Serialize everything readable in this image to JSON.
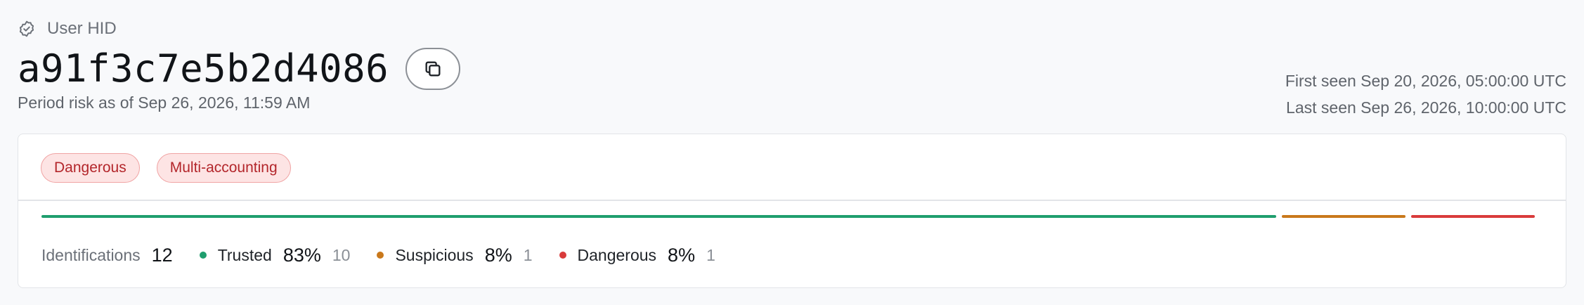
{
  "header": {
    "label": "User HID",
    "hid": "a91f3c7e5b2d4086",
    "period": "Period risk as of Sep 26, 2026, 11:59 AM",
    "first_seen": "First seen Sep 20, 2026, 05:00:00 UTC",
    "last_seen": "Last seen Sep 26, 2026, 10:00:00 UTC"
  },
  "tags": [
    "Dangerous",
    "Multi-accounting"
  ],
  "identifications": {
    "label": "Identifications",
    "total": "12",
    "groups": [
      {
        "label": "Trusted",
        "percent": "83%",
        "count": "10",
        "color": "#1f9e6e",
        "share": 0.83
      },
      {
        "label": "Suspicious",
        "percent": "8%",
        "count": "1",
        "color": "#c9781b",
        "share": 0.083
      },
      {
        "label": "Dangerous",
        "percent": "8%",
        "count": "1",
        "color": "#d93b3b",
        "share": 0.083
      }
    ]
  },
  "icons": {
    "check": "check-circle-icon",
    "copy": "copy-icon"
  }
}
